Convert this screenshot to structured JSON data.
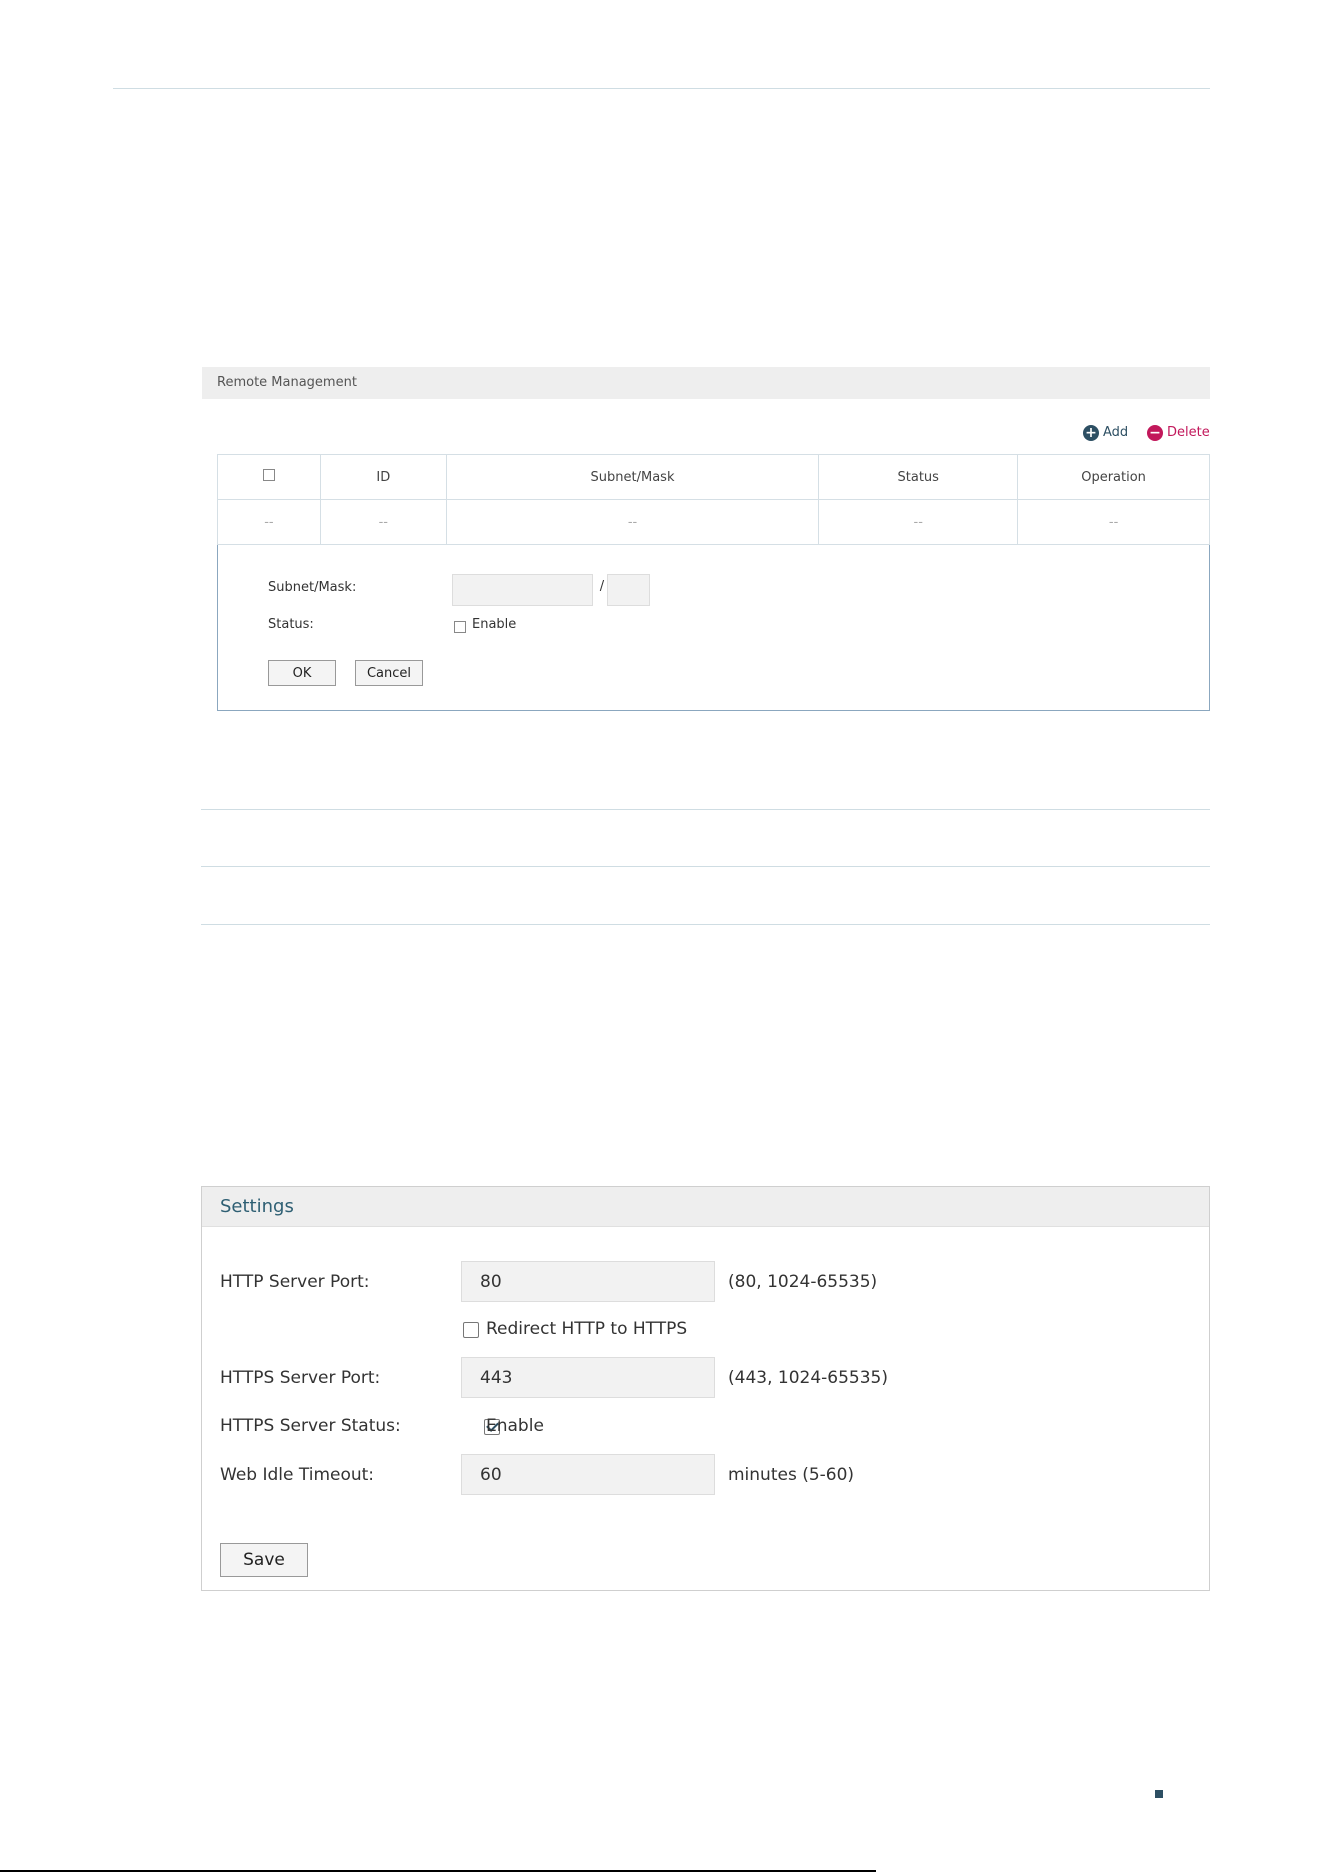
{
  "remote_management": {
    "title": "Remote Management",
    "toolbar": {
      "add_label": "Add",
      "delete_label": "Delete"
    },
    "table": {
      "columns": [
        "ID",
        "Subnet/Mask",
        "Status",
        "Operation"
      ],
      "empty_row": [
        "--",
        "--",
        "--",
        "--",
        "--"
      ]
    },
    "form": {
      "subnet_label": "Subnet/Mask:",
      "subnet_value": "",
      "separator": "/",
      "mask_value": "",
      "status_label": "Status:",
      "enable_label": "Enable",
      "ok_label": "OK",
      "cancel_label": "Cancel"
    }
  },
  "settings": {
    "title": "Settings",
    "http_port_label": "HTTP Server Port:",
    "http_port_value": "80",
    "http_port_hint": "(80, 1024-65535)",
    "redirect_label": "Redirect HTTP to HTTPS",
    "redirect_checked": false,
    "https_port_label": "HTTPS Server Port:",
    "https_port_value": "443",
    "https_port_hint": "(443, 1024-65535)",
    "https_status_label": "HTTPS Server Status:",
    "https_enable_label": "Enable",
    "https_enable_checked": true,
    "idle_timeout_label": "Web Idle Timeout:",
    "idle_timeout_value": "60",
    "idle_timeout_hint": "minutes (5-60)",
    "save_label": "Save"
  },
  "colors": {
    "accent": "#2d4f63",
    "delete": "#c2185b",
    "header_bg": "#eeeeee"
  }
}
